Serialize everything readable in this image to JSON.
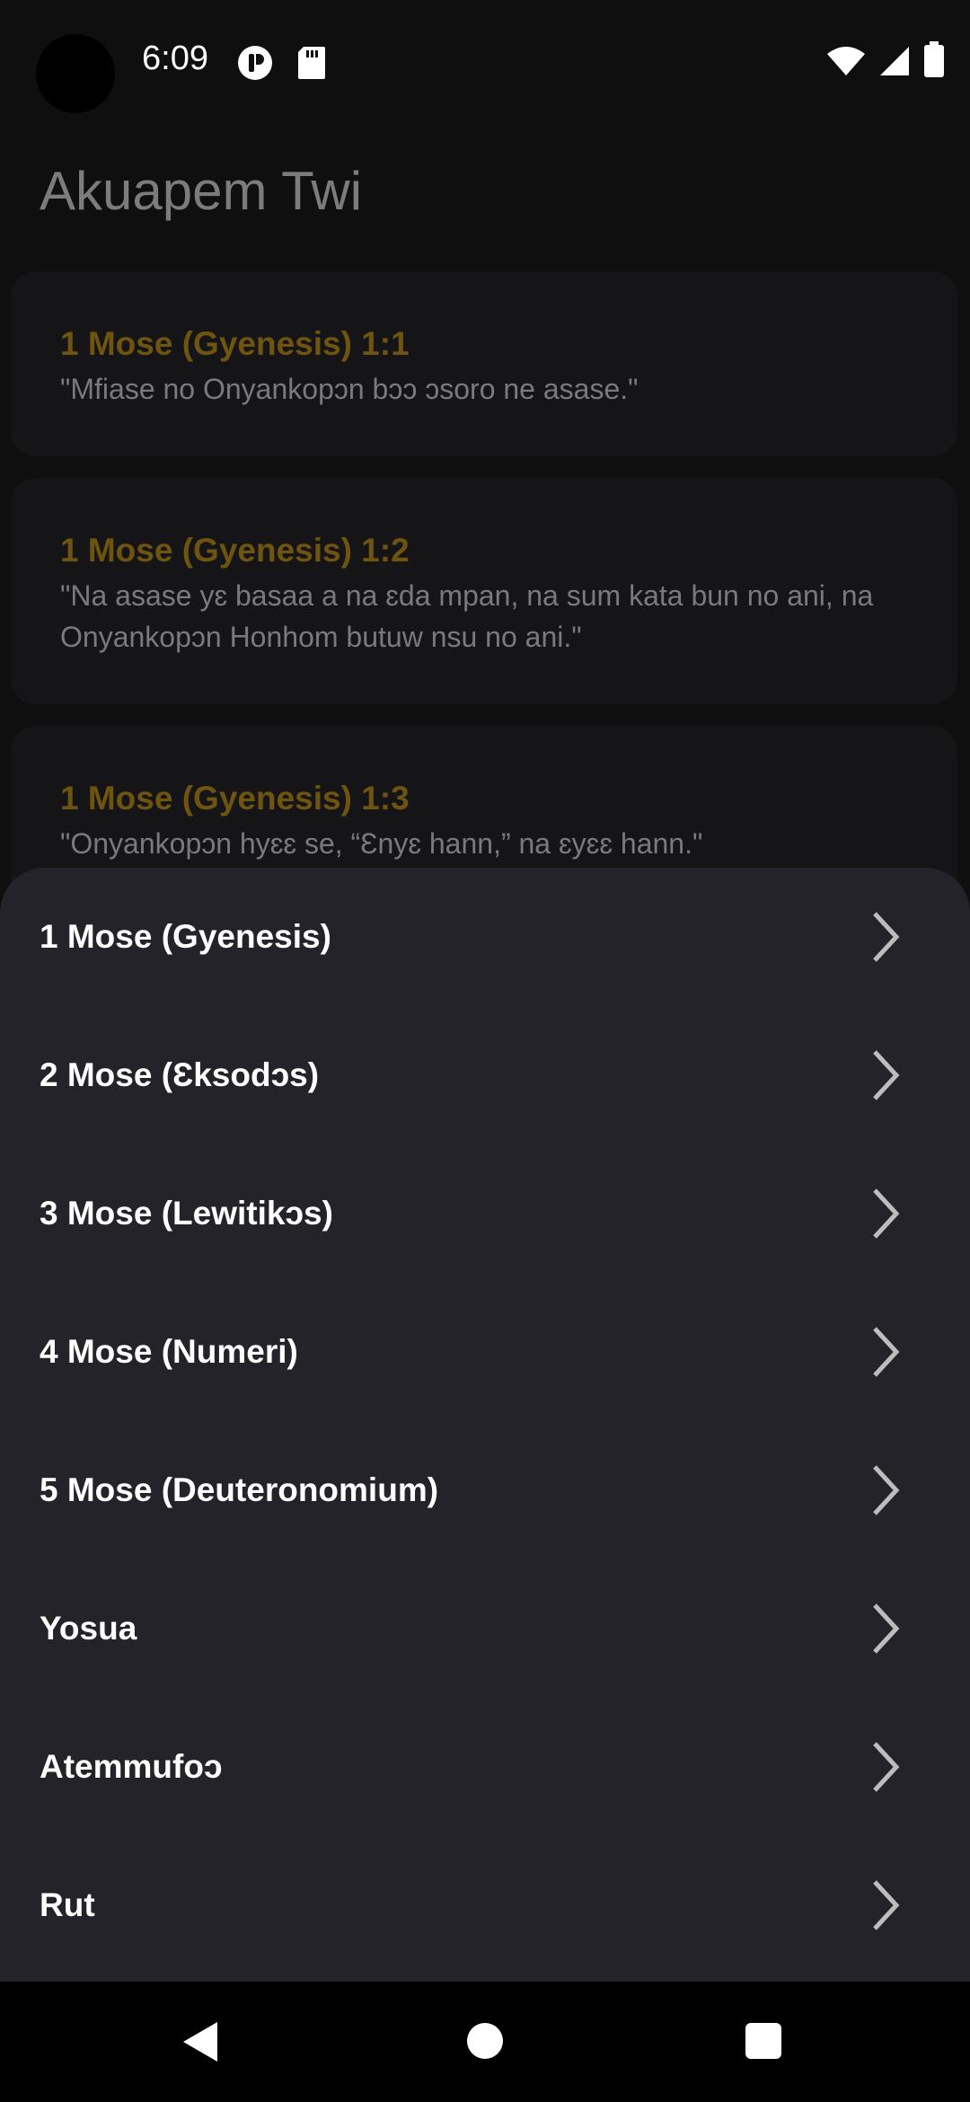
{
  "status": {
    "time": "6:09"
  },
  "app": {
    "title": "Akuapem Twi"
  },
  "verses": [
    {
      "ref": "1 Mose (Gyenesis) 1:1",
      "text": "\"Mfiase no Onyankopɔn bɔɔ ɔsoro ne asase.\""
    },
    {
      "ref": "1 Mose (Gyenesis) 1:2",
      "text": "\"Na asase yɛ basaa a na ɛda mpan, na sum kata bun no ani, na Onyankopɔn Honhom butuw nsu no ani.\""
    },
    {
      "ref": "1 Mose (Gyenesis) 1:3",
      "text": "\"Onyankopɔn hyɛɛ se, “Ɛnyɛ hann,” na ɛyɛɛ hann.\""
    }
  ],
  "books": [
    {
      "label": "1 Mose (Gyenesis)"
    },
    {
      "label": "2 Mose (Ɛksodɔs)"
    },
    {
      "label": "3 Mose (Lewitikɔs)"
    },
    {
      "label": "4 Mose (Numeri)"
    },
    {
      "label": "5 Mose (Deuteronomium)"
    },
    {
      "label": "Yosua"
    },
    {
      "label": "Atemmufoɔ"
    },
    {
      "label": "Rut"
    }
  ],
  "icons": {
    "row": "chevron-right-icon",
    "nav": [
      "back-icon",
      "home-icon",
      "recents-icon"
    ]
  },
  "colors": {
    "background": "#0f0f10",
    "sheet": "#232329",
    "card": "#151517",
    "verse_ref": "#6f5410",
    "verse_text": "#7a7a7a"
  }
}
